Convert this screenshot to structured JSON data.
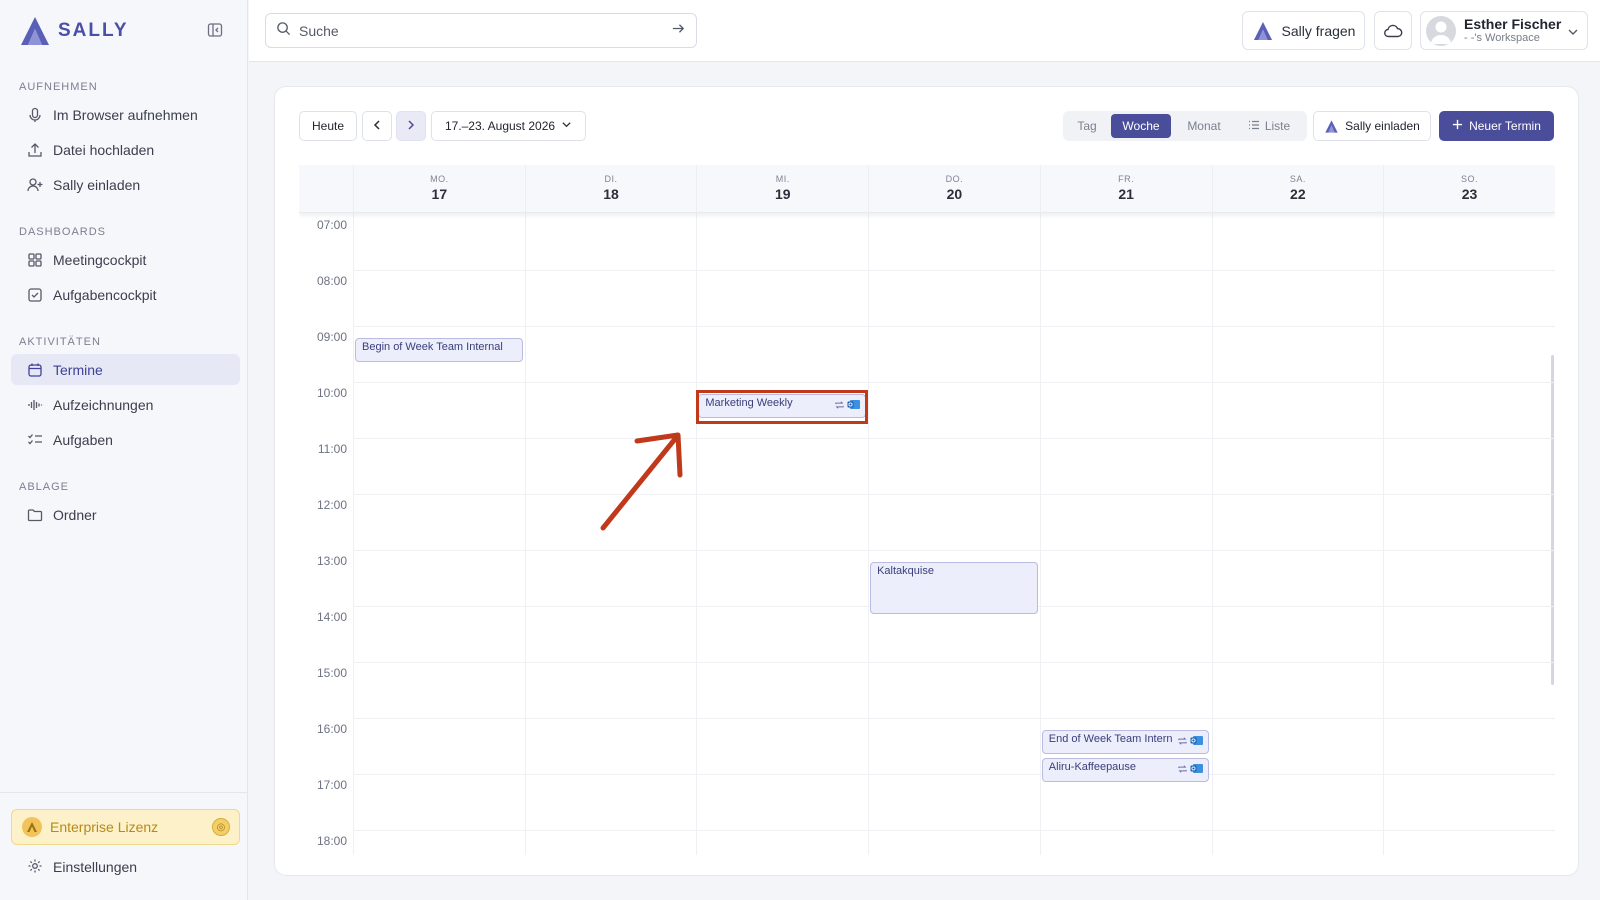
{
  "app": {
    "name": "SALLY",
    "accent": "#4a4d9a",
    "highlight_color": "#c0391b"
  },
  "sidebar": {
    "sections": [
      {
        "title": "AUFNEHMEN",
        "items": [
          {
            "label": "Im Browser aufnehmen",
            "icon": "microphone-icon"
          },
          {
            "label": "Datei hochladen",
            "icon": "upload-icon"
          },
          {
            "label": "Sally einladen",
            "icon": "user-plus-icon"
          }
        ]
      },
      {
        "title": "DASHBOARDS",
        "items": [
          {
            "label": "Meetingcockpit",
            "icon": "grid-icon"
          },
          {
            "label": "Aufgabencockpit",
            "icon": "checkbox-icon"
          }
        ]
      },
      {
        "title": "AKTIVITÄTEN",
        "items": [
          {
            "label": "Termine",
            "icon": "calendar-icon",
            "active": true
          },
          {
            "label": "Aufzeichnungen",
            "icon": "waveform-icon"
          },
          {
            "label": "Aufgaben",
            "icon": "checklist-icon"
          }
        ]
      },
      {
        "title": "ABLAGE",
        "items": [
          {
            "label": "Ordner",
            "icon": "folder-icon"
          }
        ]
      }
    ],
    "license_label": "Enterprise Lizenz",
    "settings_label": "Einstellungen"
  },
  "topbar": {
    "search_placeholder": "Suche",
    "ask_label": "Sally fragen",
    "user_name": "Esther Fischer",
    "workspace": "- -'s Workspace"
  },
  "toolbar": {
    "today": "Heute",
    "date_range": "17.–23. August 2026",
    "views": [
      "Tag",
      "Woche",
      "Monat",
      "Liste"
    ],
    "active_view": "Woche",
    "invite": "Sally einladen",
    "new_event": "Neuer Termin"
  },
  "calendar": {
    "days": [
      {
        "weekday": "MO.",
        "date": "17"
      },
      {
        "weekday": "DI.",
        "date": "18"
      },
      {
        "weekday": "MI.",
        "date": "19"
      },
      {
        "weekday": "DO.",
        "date": "20"
      },
      {
        "weekday": "FR.",
        "date": "21"
      },
      {
        "weekday": "SA.",
        "date": "22"
      },
      {
        "weekday": "SO.",
        "date": "23"
      }
    ],
    "hours": [
      "07:00",
      "08:00",
      "09:00",
      "10:00",
      "11:00",
      "12:00",
      "13:00",
      "14:00",
      "15:00",
      "16:00",
      "17:00",
      "18:00"
    ],
    "events": [
      {
        "title": "Begin of Week Team Internal",
        "day": "17",
        "start": "09:00",
        "end": "09:30",
        "icons": []
      },
      {
        "title": "Marketing Weekly",
        "day": "19",
        "start": "10:00",
        "end": "10:30",
        "icons": [
          "repeat-icon",
          "outlook-icon"
        ],
        "highlighted": true
      },
      {
        "title": "Kaltakquise",
        "day": "20",
        "start": "13:00",
        "end": "14:00",
        "icons": []
      },
      {
        "title": "End of Week Team Intern",
        "day": "21",
        "start": "16:00",
        "end": "16:30",
        "icons": [
          "repeat-icon",
          "outlook-icon"
        ]
      },
      {
        "title": "Aliru-Kaffeepause",
        "day": "21",
        "start": "16:30",
        "end": "17:00",
        "icons": [
          "repeat-icon",
          "outlook-icon"
        ]
      }
    ]
  }
}
